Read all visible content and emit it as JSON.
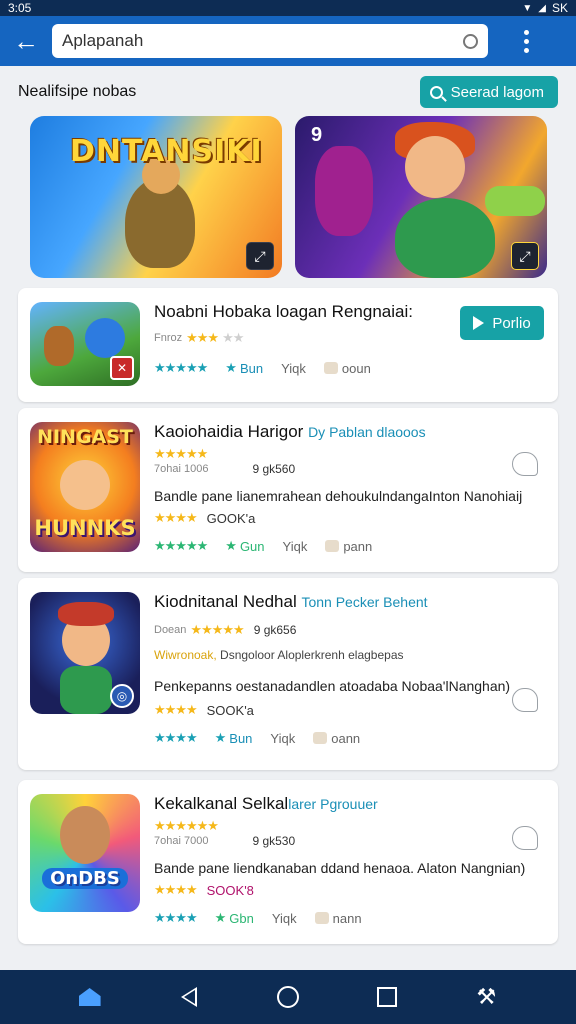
{
  "status_bar": {
    "time": "3:05",
    "right_text": "SK"
  },
  "search": {
    "value": "Aplapanah"
  },
  "section": {
    "title": "Nealifsipe nobas",
    "search_game_label": "Seerad lagom"
  },
  "banners": [
    {
      "title": "DNTANSIKI"
    },
    {
      "number": "9"
    }
  ],
  "apps": [
    {
      "title": "Noabni Hobaka loagan Rengnaiai:",
      "meta": "Fnroz",
      "stars": "★★★★★",
      "action_1": "Bun",
      "action_2": "Yiqk",
      "action_3": "ooun",
      "button": "Porlio"
    },
    {
      "title": "Kaoiohaidia Harigor",
      "developer": "Dy Pablan dlaooos",
      "meta": "7ohai 1006",
      "count": "9 gk560",
      "description": "Bandle pane lianemrahean dehoukulndangaInton Nanohiaij",
      "stat": "GOOK'a",
      "action_1": "Gun",
      "action_2": "Yiqk",
      "action_3": "pann",
      "icon_top": "NINGAST",
      "icon_bottom": "HUNNKS"
    },
    {
      "title": "Kiodnitanal Nedhal",
      "developer": "Tonn Pecker Behent",
      "meta": "Doean",
      "count": "9 gk656",
      "tagline_highlight": "Wiwronoak,",
      "tagline": "Dsngoloor Aloplerkrenh elagbepas",
      "description": "Penkepanns oestanadandlen atoadaba Nobaa'lNanghan)",
      "stat": "SOOK'a",
      "action_1": "Bun",
      "action_2": "Yiqk",
      "action_3": "oann"
    },
    {
      "title": "Kekalkanal Selkal",
      "developer": "larer Pgrouuer",
      "meta": "7ohai 7000",
      "count": "9 gk530",
      "description": "Bande pane liendkanaban ddand henaoa. Alaton Nangnian)",
      "stat": "SOOK'8",
      "action_1": "Gbn",
      "action_2": "Yiqk",
      "action_3": "nann",
      "icon_bottom": "OnDBS"
    }
  ],
  "colors": {
    "app_bar": "#1565c0",
    "accent": "#17a2a6",
    "nav": "#0d2c54",
    "star": "#f5b81a"
  }
}
